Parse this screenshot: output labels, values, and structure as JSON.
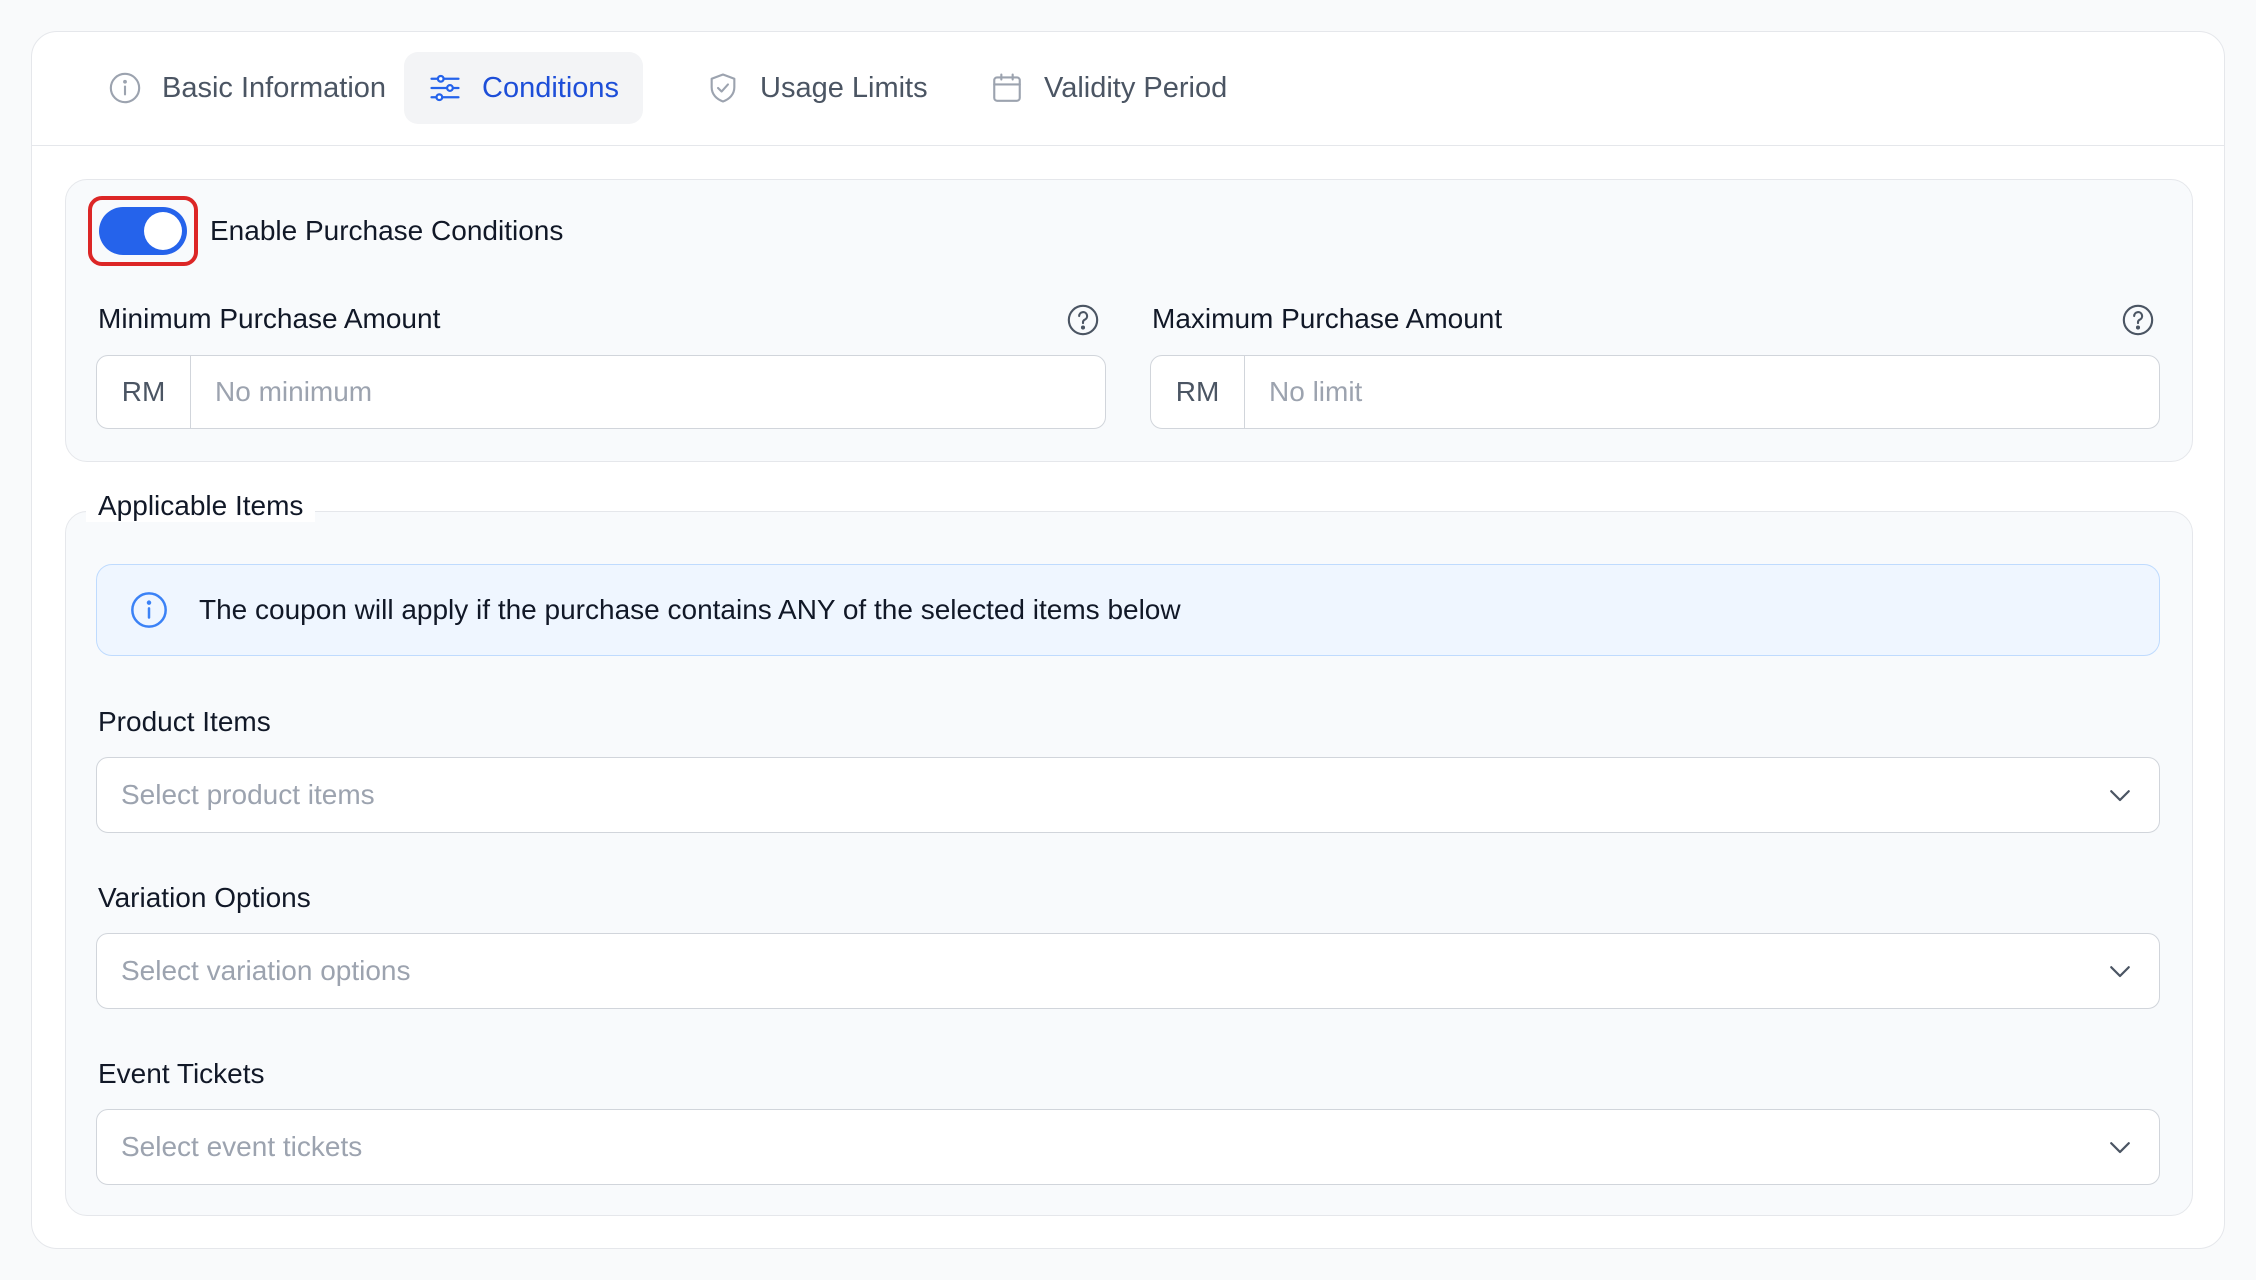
{
  "tabs": [
    {
      "label": "Basic Information",
      "icon": "info-circle-icon"
    },
    {
      "label": "Conditions",
      "icon": "sliders-icon"
    },
    {
      "label": "Usage Limits",
      "icon": "shield-check-icon"
    },
    {
      "label": "Validity Period",
      "icon": "calendar-icon"
    }
  ],
  "active_tab": "Conditions",
  "purchase_conditions": {
    "toggle_label": "Enable Purchase Conditions",
    "enabled": true,
    "min": {
      "label": "Minimum Purchase Amount",
      "prefix": "RM",
      "placeholder": "No minimum",
      "value": ""
    },
    "max": {
      "label": "Maximum Purchase Amount",
      "prefix": "RM",
      "placeholder": "No limit",
      "value": ""
    }
  },
  "applicable_items": {
    "legend": "Applicable Items",
    "info": "The coupon will apply if the purchase contains ANY of the selected items below",
    "product": {
      "label": "Product Items",
      "placeholder": "Select product items"
    },
    "variation": {
      "label": "Variation Options",
      "placeholder": "Select variation options"
    },
    "tickets": {
      "label": "Event Tickets",
      "placeholder": "Select event tickets"
    }
  },
  "colors": {
    "accent": "#2563eb",
    "active_tab_text": "#1d4ed8",
    "highlight_border": "#dc2626",
    "info_bg": "#eff6ff"
  }
}
